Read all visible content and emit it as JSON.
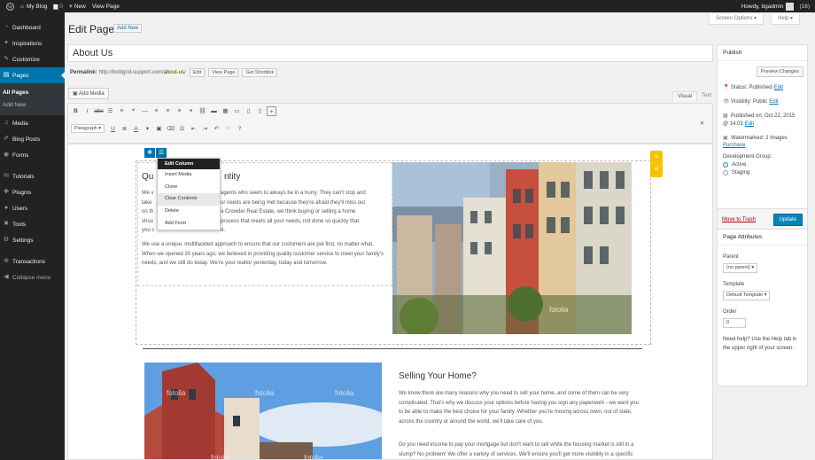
{
  "adminbar": {
    "site": "My Blog",
    "comments": "0",
    "new": "New",
    "view_page": "View Page",
    "howdy": "Howdy, bgadmin",
    "count": "(16)"
  },
  "sidebar": {
    "items": [
      {
        "label": "Dashboard",
        "icon": "dashboard-icon"
      },
      {
        "label": "Inspirations",
        "icon": "lightbulb-icon"
      },
      {
        "label": "Customize",
        "icon": "brush-icon"
      },
      {
        "label": "Pages",
        "icon": "pages-icon"
      },
      {
        "label": "Media",
        "icon": "media-icon"
      },
      {
        "label": "Blog Posts",
        "icon": "pin-icon"
      },
      {
        "label": "Forms",
        "icon": "forms-icon"
      },
      {
        "label": "Tutorials",
        "icon": "tutorials-icon"
      },
      {
        "label": "Plugins",
        "icon": "plugin-icon"
      },
      {
        "label": "Users",
        "icon": "users-icon"
      },
      {
        "label": "Tools",
        "icon": "tools-icon"
      },
      {
        "label": "Settings",
        "icon": "settings-icon"
      },
      {
        "label": "Transactions",
        "icon": "transactions-icon"
      },
      {
        "label": "Collapse menu",
        "icon": "collapse-icon"
      }
    ],
    "submenu": [
      "All Pages",
      "Add New"
    ]
  },
  "header": {
    "screen_options": "Screen Options ▾",
    "help": "Help ▾",
    "title": "Edit Page",
    "add_new": "Add New"
  },
  "post": {
    "title": "About Us",
    "permalink_label": "Permalink:",
    "permalink_base": "http://boldgrid-support.com/",
    "permalink_slug": "about-us",
    "permalink_end": "/",
    "edit": "Edit",
    "view_page": "View Page",
    "get_shortlink": "Get Shortlink",
    "add_media": "Add Media",
    "tab_visual": "Visual",
    "tab_text": "Text",
    "format_select": "Paragraph"
  },
  "editor": {
    "dropdown": [
      "Edit Column",
      "Insert Media",
      "Clone",
      "Clear Contents",
      "Delete",
      "Add Form"
    ],
    "heading1_start": "Qu",
    "heading1_end": "ntity",
    "p1_lines": [
      [
        "We v",
        "agents who seem to always be in a hurry. They can't stop and"
      ],
      [
        "take",
        "ur needs are being met because they're afraid they'll miss out"
      ],
      [
        "on th",
        "a Crowder Real Estate, we think buying or selling a home"
      ],
      [
        "shou",
        "process that meets all your needs, not done so quickly that"
      ],
      [
        "you c",
        "d."
      ]
    ],
    "p2": "We use a unique, multifaceted approach to ensure that our customers are put first, no matter what. When we opened 30 years ago, we believed in providing quality customer service to meet your family's needs, and we still do today. We're your realtor yesterday, today and tomorrow.",
    "heading2": "Selling Your Home?",
    "p3": "We know there are many reasons why you need to sell your home, and some of them can be very complicated. That's why we discuss your options before having you sign any paperwork - we want you to be able to make the best choice for your family. Whether you're moving across town, out of state, across the country or around the world, we'll take care of you.",
    "p4": "Do you need income to pay your mortgage but don't want to sell while the housing market is still in a slump? No problem! We offer a variety of services. We'll ensure you'll get more visibility in a specific market to get the right price. If you'd rather rent your home, we'll",
    "watermark": "fotolia"
  },
  "publish": {
    "title": "Publish",
    "preview": "Preview Changes",
    "status_label": "Status: Published",
    "visibility_label": "Visibility: Public",
    "published_on": "Published on: Oct 22, 2015",
    "published_time": "@ 14:03",
    "edit": "Edit",
    "watermarked": "Watermarked: 2 Images",
    "purchase": "Purchase",
    "dev_group": "Development Group:",
    "active": "Active",
    "staging": "Staging",
    "trash": "Move to Trash",
    "update": "Update"
  },
  "attributes": {
    "title": "Page Attributes",
    "parent_label": "Parent",
    "parent_value": "(no parent) ▾",
    "template_label": "Template",
    "template_value": "Default Template ▾",
    "order_label": "Order",
    "order_value": "0",
    "help": "Need help? Use the Help tab in the upper right of your screen."
  }
}
